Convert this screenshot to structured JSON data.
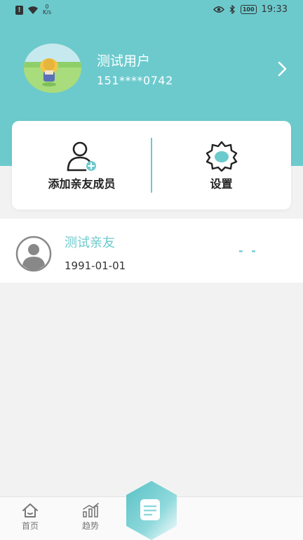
{
  "status_bar": {
    "net_speed_value": "0",
    "net_speed_unit": "K/s",
    "battery": "100",
    "time": "19:33"
  },
  "profile": {
    "name": "测试用户",
    "phone": "151****0742"
  },
  "actions": {
    "add_member_label": "添加亲友成员",
    "settings_label": "设置"
  },
  "friends": [
    {
      "name": "测试亲友",
      "birthdate": "1991-01-01",
      "value": "- -"
    }
  ],
  "tabbar": {
    "home_label": "首页",
    "trend_label": "趋势"
  },
  "colors": {
    "accent": "#6ccacd",
    "background": "#f2f2f2"
  }
}
